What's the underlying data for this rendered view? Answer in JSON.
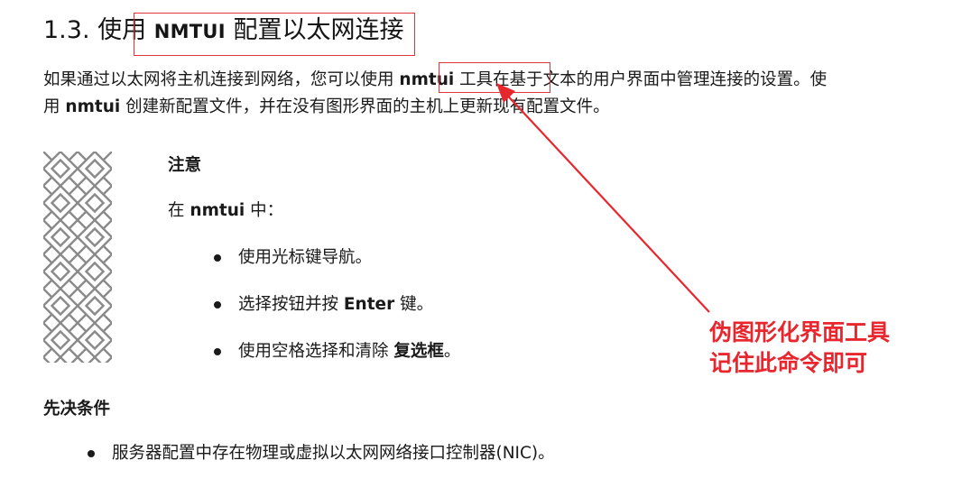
{
  "heading": {
    "number": "1.3.",
    "prefix": "使用",
    "command": "NMTUI",
    "suffix": "配置以太网连接"
  },
  "intro": {
    "line1_before": "如果通过以太网将主机连接到网络，您可以使用",
    "line1_cmd": "nmtui",
    "line1_after": "工具在基于文本的用户界面中管理连接的设置。使",
    "line2_before": "用",
    "line2_cmd": "nmtui",
    "line2_after": "创建新配置文件，并在没有图形界面的主机上更新现有配置文件。"
  },
  "note": {
    "title": "注意",
    "intro_before": "在",
    "intro_cmd": "nmtui",
    "intro_after": "中：",
    "items": [
      {
        "text": "使用光标键导航。"
      },
      {
        "before": "选择按钮并按",
        "bold": "Enter",
        "after": "键。"
      },
      {
        "before": "使用空格选择和清除",
        "bold": "复选框",
        "after": "。"
      }
    ]
  },
  "prerequisites": {
    "title": "先决条件",
    "items": [
      {
        "text": "服务器配置中存在物理或虚拟以太网网络接口控制器(NIC)。"
      }
    ]
  },
  "annotation": {
    "line1": "伪图形化界面工具",
    "line2": "记住此命令即可",
    "color": "#e8262e"
  }
}
